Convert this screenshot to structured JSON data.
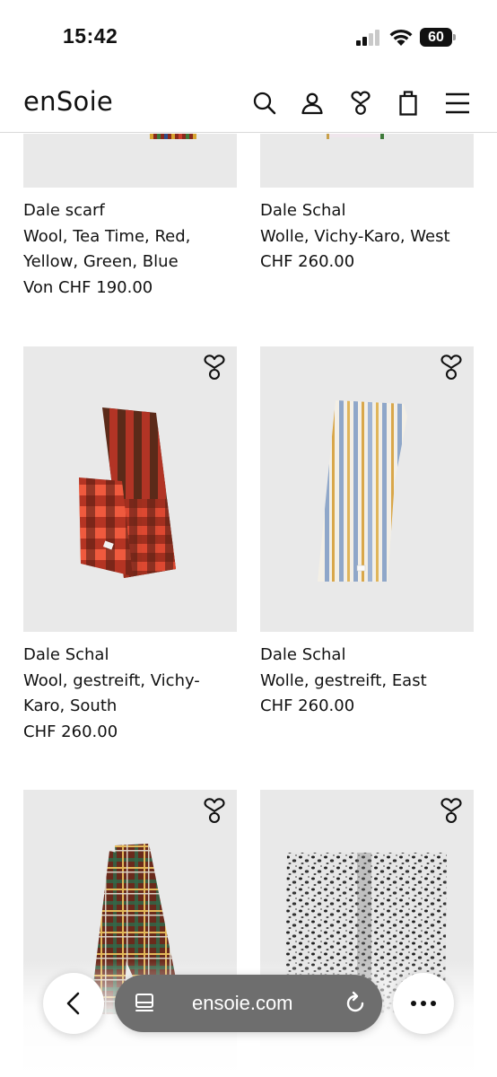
{
  "status_bar": {
    "time": "15:42",
    "battery_level": "60",
    "signal_bars_active": 2,
    "signal_bars_total": 4
  },
  "header": {
    "logo": "enSoie",
    "icons": [
      "search-icon",
      "account-icon",
      "wishlist-icon",
      "bag-icon",
      "menu-icon"
    ]
  },
  "products": [
    {
      "name": "Dale scarf",
      "desc_line1": "Wool, Tea Time, Red,",
      "desc_line2": "Yellow, Green, Blue",
      "price": "Von CHF 190.00"
    },
    {
      "name": "Dale Schal",
      "desc_line1": "Wolle, Vichy-Karo, West",
      "price": "CHF 260.00"
    },
    {
      "name": "Dale Schal",
      "desc_line1": "Wool, gestreift, Vichy-",
      "desc_line2": "Karo, South",
      "price": "CHF 260.00"
    },
    {
      "name": "Dale Schal",
      "desc_line1": "Wolle, gestreift, East",
      "price": "CHF 260.00"
    },
    {
      "name": "",
      "desc_line1": "",
      "price": ""
    },
    {
      "name": "",
      "desc_line1": "",
      "price": ""
    }
  ],
  "browser": {
    "url": "ensoie.com"
  },
  "colors": {
    "image_background": "#e9e9e9",
    "url_pill": "#6e6e6e",
    "text": "#111111"
  }
}
